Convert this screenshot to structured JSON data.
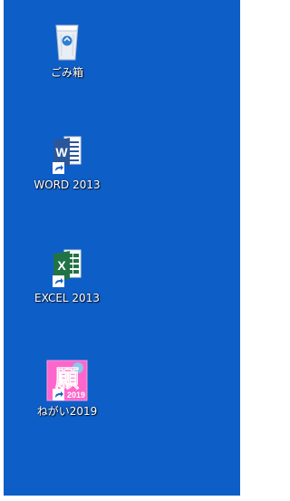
{
  "desktop": {
    "background_color": "#0e5ec7",
    "icons": [
      {
        "label": "ごみ箱",
        "icon": "recycle-bin-icon",
        "shortcut": false
      },
      {
        "label": "WORD 2013",
        "icon": "word-icon",
        "shortcut": true,
        "accent": "#2b579a"
      },
      {
        "label": "EXCEL 2013",
        "icon": "excel-icon",
        "shortcut": true,
        "accent": "#217346"
      },
      {
        "label": "ねがい2019",
        "icon": "negai-app-icon",
        "shortcut": true,
        "accent": "#ff66cc",
        "logo_text": "願",
        "logo_sub": "2019"
      }
    ]
  }
}
